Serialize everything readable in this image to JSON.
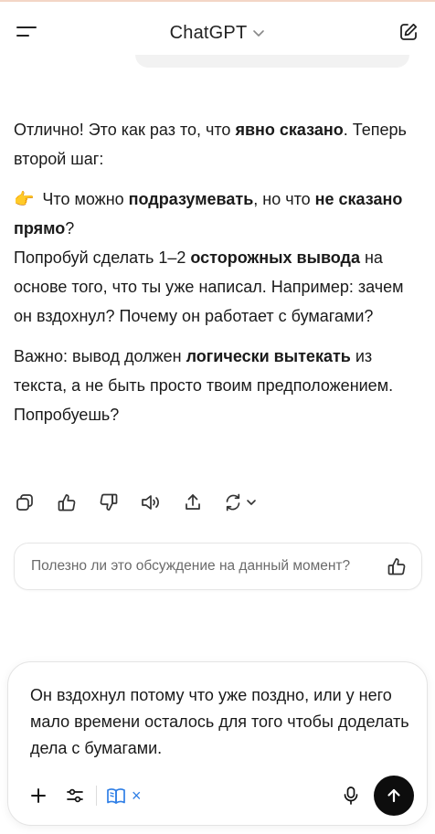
{
  "header": {
    "title": "ChatGPT",
    "icons": {
      "menu": "menu-icon",
      "title_chevron": "chevron-down-icon",
      "new_chat": "edit-icon"
    }
  },
  "message": {
    "p1": {
      "t1": "Отлично! Это как раз то, что ",
      "b1": "явно сказано",
      "t2": ". Теперь второй шаг:"
    },
    "p2": {
      "emoji": "👉",
      "t1": " Что можно ",
      "b1": "подразумевать",
      "t2": ", но что ",
      "b2": "не сказано прямо",
      "t3": "?"
    },
    "p3": {
      "t1": "Попробуй сделать 1–2 ",
      "b1": "осторожных вывода",
      "t2": " на основе того, что ты уже написал. Например: зачем он вздохнул? Почему он работает с бумагами?"
    },
    "p4": {
      "t1": "Важно: вывод должен ",
      "b1": "логически вытекать",
      "t2": " из текста, а не быть просто твоим предположением. Попробуешь?"
    }
  },
  "actions": {
    "icons": [
      "copy-icon",
      "thumbs-up-icon",
      "thumbs-down-icon",
      "speaker-icon",
      "share-icon",
      "regenerate-icon"
    ]
  },
  "feedback": {
    "question": "Полезно ли это обсуждение на данный момент?",
    "icon": "thumbs-up-icon"
  },
  "composer": {
    "text": "Он вздохнул потому что уже поздно, или у него мало времени осталось для того чтобы доделать дела с бумагами.",
    "chip_close": "×",
    "icons": {
      "add": "plus-icon",
      "tools": "sliders-icon",
      "chip": "book-open-icon",
      "mic": "microphone-icon",
      "send": "arrow-up-icon"
    },
    "colors": {
      "chip": "#2f7fe6",
      "send_bg": "#0d0d0d"
    }
  }
}
